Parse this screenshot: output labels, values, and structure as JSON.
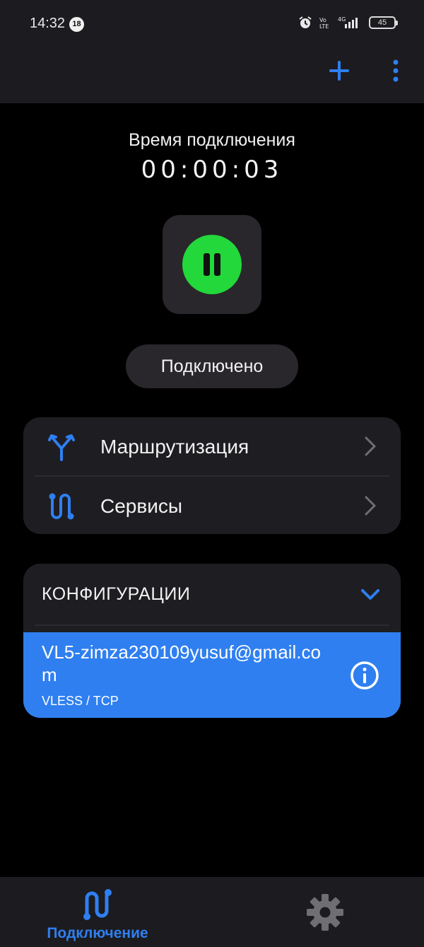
{
  "status_bar": {
    "time": "14:32",
    "badge": "18",
    "network": "4G",
    "battery": "45"
  },
  "toolbar": {
    "add_icon": "plus-icon",
    "more_icon": "more-vertical-icon"
  },
  "connection": {
    "label": "Время подключения",
    "timer": "00:00:03",
    "state": "Подключено",
    "button_color": "#22d83a"
  },
  "menu": [
    {
      "label": "Маршрутизация",
      "icon": "route-split-icon"
    },
    {
      "label": "Сервисы",
      "icon": "services-path-icon"
    }
  ],
  "configurations": {
    "title": "КОНФИГУРАЦИИ",
    "items": [
      {
        "name": "VL5-zimza230109yusuf@gmail.com",
        "protocol": "VLESS / TCP"
      }
    ]
  },
  "bottom_nav": {
    "connection_label": "Подключение",
    "active_color": "#2f7ff0"
  }
}
